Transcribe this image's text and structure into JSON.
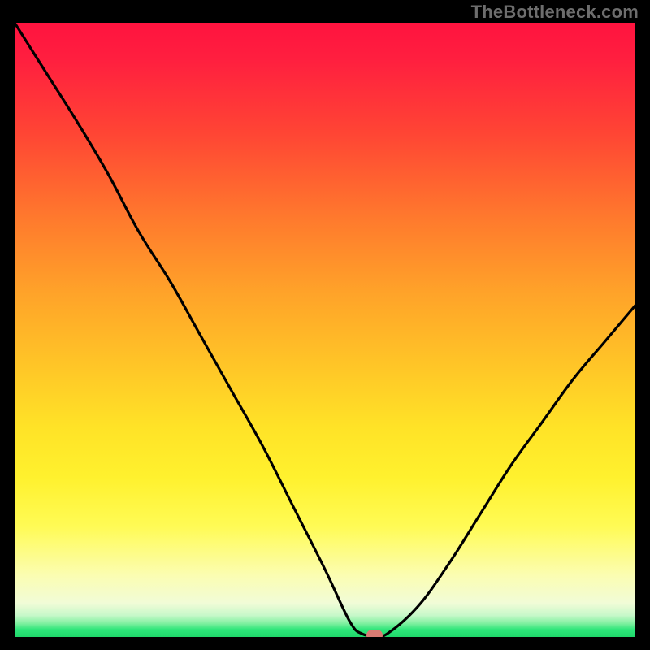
{
  "watermark": "TheBottleneck.com",
  "colors": {
    "frame": "#000000",
    "marker": "#d97b73",
    "curve": "#000000",
    "gradient_top": "#ff133f",
    "gradient_bottom": "#1fd76a"
  },
  "chart_data": {
    "type": "line",
    "title": "",
    "xlabel": "",
    "ylabel": "",
    "xlim": [
      0,
      100
    ],
    "ylim": [
      0,
      100
    ],
    "x": [
      0,
      5,
      10,
      15,
      20,
      25,
      30,
      35,
      40,
      45,
      50,
      54,
      56,
      58,
      60,
      65,
      70,
      75,
      80,
      85,
      90,
      95,
      100
    ],
    "values": [
      100,
      92,
      84,
      75.5,
      66,
      58,
      49,
      40,
      31,
      21,
      11,
      2.5,
      0.5,
      0.3,
      0.5,
      5,
      12,
      20,
      28,
      35,
      42,
      48,
      54
    ],
    "marker": {
      "x": 58,
      "y": 0.3
    },
    "annotations": []
  }
}
